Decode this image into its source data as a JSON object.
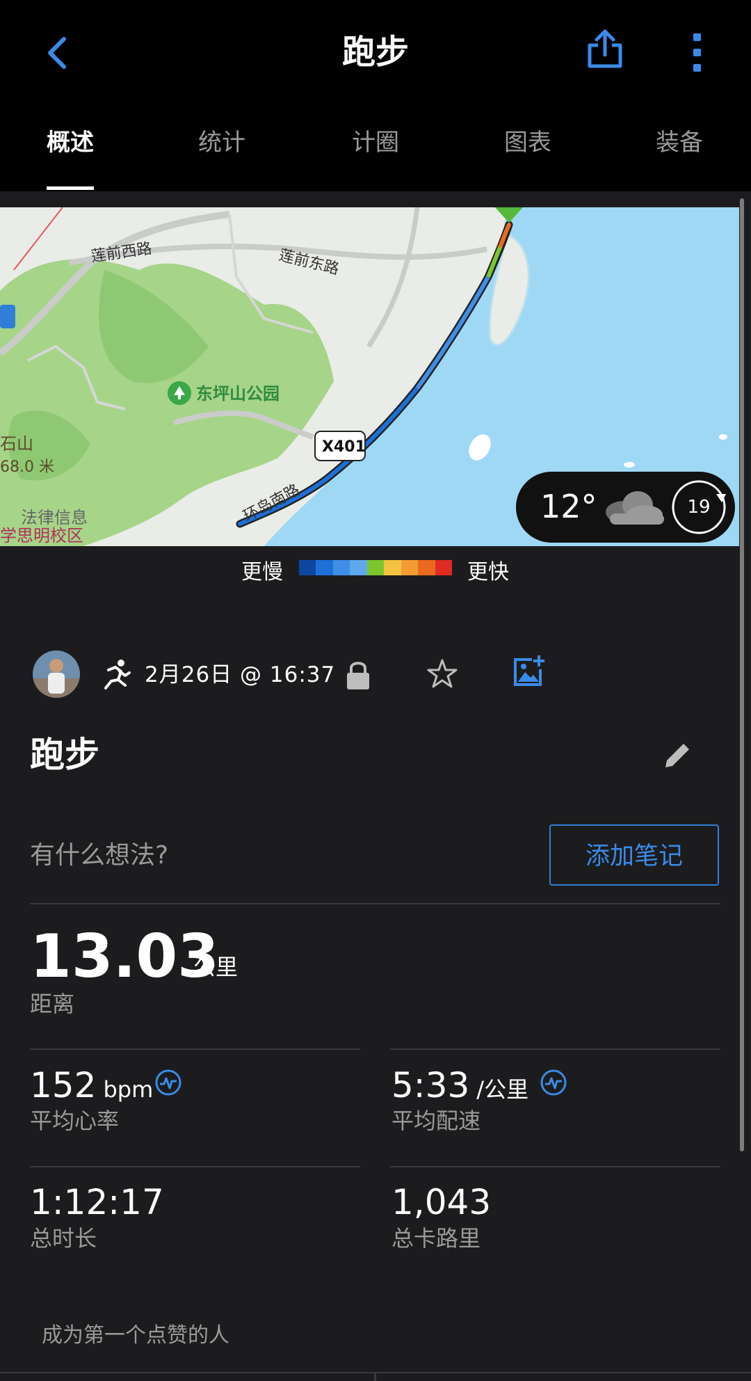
{
  "header": {
    "title": "跑步",
    "back_icon": "chevron-left-icon",
    "share_icon": "share-icon",
    "more_icon": "more-vertical-icon"
  },
  "tabs": [
    {
      "label": "概述",
      "active": true
    },
    {
      "label": "统计",
      "active": false
    },
    {
      "label": "计圈",
      "active": false
    },
    {
      "label": "图表",
      "active": false
    },
    {
      "label": "装备",
      "active": false
    }
  ],
  "map": {
    "labels": {
      "road1": "莲前西路",
      "road2": "莲前东路",
      "park": "东坪山公园",
      "route_badge": "X401",
      "road3": "环岛南路",
      "peak": "石山",
      "peak_height": "68.0 米",
      "poi1": "法律信息",
      "poi2": "学思明校区"
    },
    "weather": {
      "temperature": "12°",
      "condition_icon": "cloud-icon",
      "wind_value": "19"
    }
  },
  "legend": {
    "slower": "更慢",
    "faster": "更快",
    "colors": [
      "#0d47a1",
      "#1e6fd6",
      "#3f8ee6",
      "#5fa8ee",
      "#7cc62e",
      "#f5c342",
      "#f39c34",
      "#ec6a1f",
      "#e02b24"
    ]
  },
  "activity": {
    "datetime": "2月26日 @ 16:37",
    "title": "跑步",
    "thoughts_placeholder": "有什么想法?",
    "add_note": "添加笔记"
  },
  "stats": {
    "distance": {
      "value": "13.03",
      "unit": "公里",
      "label": "距离"
    },
    "heart_rate": {
      "value": "152",
      "unit": "bpm",
      "label": "平均心率"
    },
    "pace": {
      "value": "5:33",
      "unit": "/公里",
      "label": "平均配速"
    },
    "duration": {
      "value": "1:12:17",
      "label": "总时长"
    },
    "calories": {
      "value": "1,043",
      "label": "总卡路里"
    }
  },
  "social": {
    "likes_text": "成为第一个点赞的人"
  },
  "colors": {
    "accent": "#3a8be8",
    "background": "#1c1c1e",
    "topbar": "#000000",
    "water": "#9fd8f5",
    "land": "#e9ece7",
    "green": "#a6d489"
  }
}
